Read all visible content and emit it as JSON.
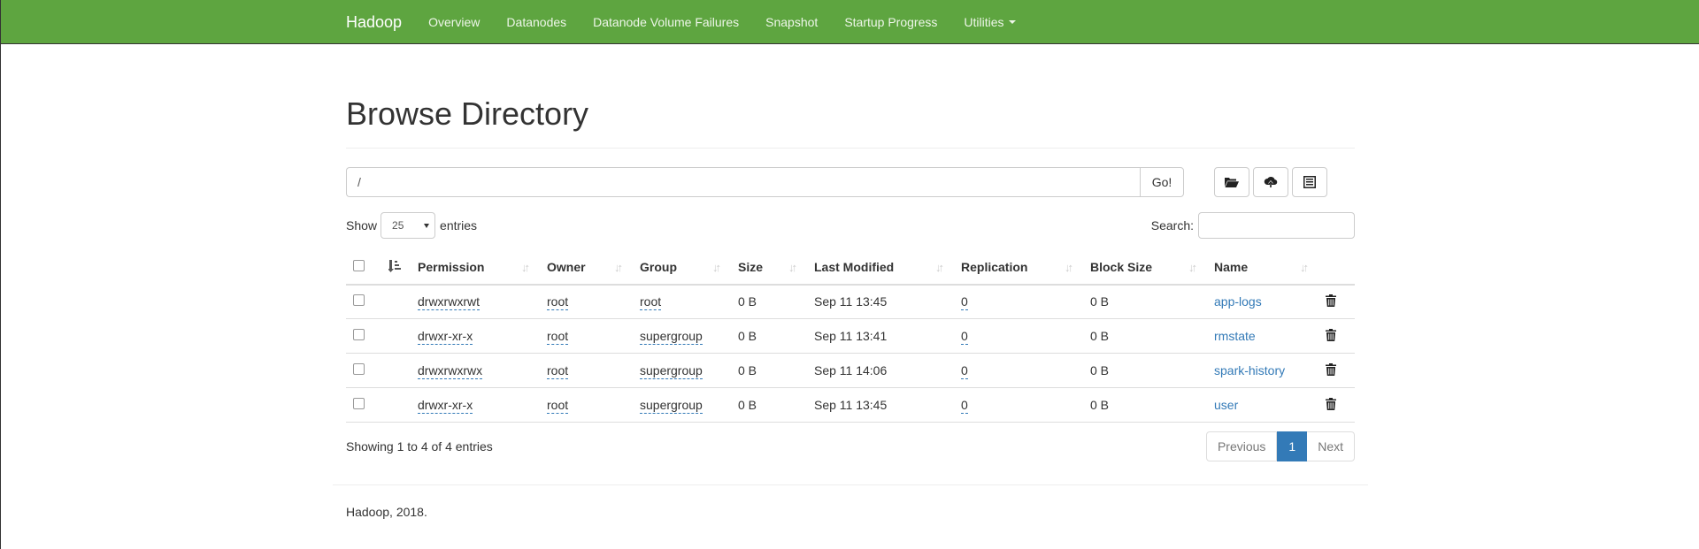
{
  "navbar": {
    "brand": "Hadoop",
    "items": [
      "Overview",
      "Datanodes",
      "Datanode Volume Failures",
      "Snapshot",
      "Startup Progress"
    ],
    "utilities": "Utilities"
  },
  "page": {
    "title": "Browse Directory",
    "path_value": "/",
    "go_label": "Go!"
  },
  "controls": {
    "show_label": "Show",
    "entries_value": "25",
    "entries_label": "entries",
    "search_label": "Search:"
  },
  "table": {
    "headers": [
      "Permission",
      "Owner",
      "Group",
      "Size",
      "Last Modified",
      "Replication",
      "Block Size",
      "Name"
    ],
    "rows": [
      {
        "permission": "drwxrwxrwt",
        "owner": "root",
        "group": "root",
        "size": "0 B",
        "modified": "Sep 11 13:45",
        "replication": "0",
        "block_size": "0 B",
        "name": "app-logs"
      },
      {
        "permission": "drwxr-xr-x",
        "owner": "root",
        "group": "supergroup",
        "size": "0 B",
        "modified": "Sep 11 13:41",
        "replication": "0",
        "block_size": "0 B",
        "name": "rmstate"
      },
      {
        "permission": "drwxrwxrwx",
        "owner": "root",
        "group": "supergroup",
        "size": "0 B",
        "modified": "Sep 11 14:06",
        "replication": "0",
        "block_size": "0 B",
        "name": "spark-history"
      },
      {
        "permission": "drwxr-xr-x",
        "owner": "root",
        "group": "supergroup",
        "size": "0 B",
        "modified": "Sep 11 13:45",
        "replication": "0",
        "block_size": "0 B",
        "name": "user"
      }
    ]
  },
  "info": {
    "showing": "Showing 1 to 4 of 4 entries",
    "previous": "Previous",
    "current_page": "1",
    "next": "Next"
  },
  "footer": {
    "text": "Hadoop, 2018."
  },
  "colors": {
    "navbar": "#5ea540",
    "link": "#337ab7",
    "active_page": "#337ab7"
  }
}
